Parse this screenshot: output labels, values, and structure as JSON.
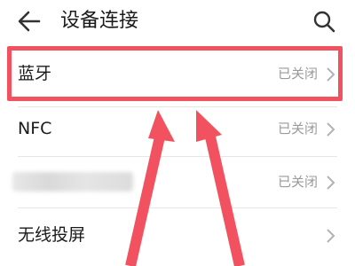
{
  "header": {
    "title": "设备连接",
    "back_icon": "back-arrow-icon",
    "search_icon": "search-icon"
  },
  "settings": [
    {
      "label": "蓝牙",
      "status": "已关闭"
    },
    {
      "label": "NFC",
      "status": "已关闭"
    },
    {
      "label": "",
      "status": "已关闭",
      "label_redacted": true
    },
    {
      "label": "无线投屏",
      "status": ""
    }
  ],
  "annotation": {
    "highlight_color": "#f2525f",
    "highlighted_row": "蓝牙",
    "arrow_count": 2
  }
}
